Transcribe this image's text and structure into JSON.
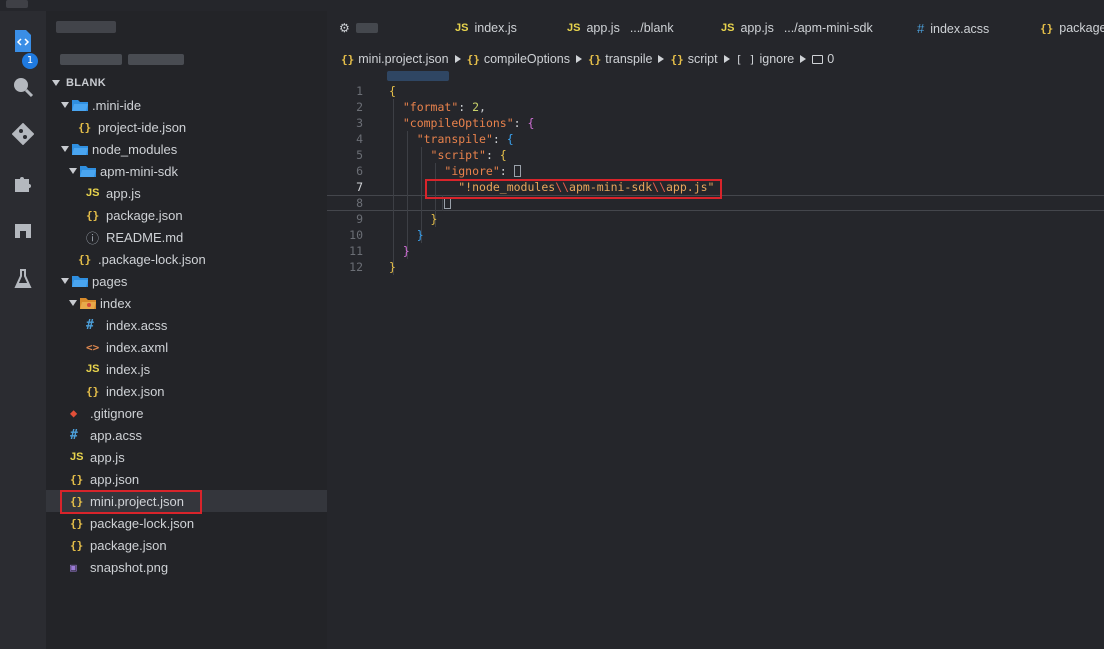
{
  "sidebar": {
    "section_title": "BLANK",
    "tree": [
      {
        "label": ".mini-ide",
        "icon": "folder-open-icon",
        "type": "folder",
        "indent": 1,
        "expanded": true
      },
      {
        "label": "project-ide.json",
        "icon": "json-icon",
        "type": "json",
        "indent": 2
      },
      {
        "label": "node_modules",
        "icon": "folder-open-icon",
        "type": "folder",
        "indent": 1,
        "expanded": true
      },
      {
        "label": "apm-mini-sdk",
        "icon": "folder-open-icon",
        "type": "folder",
        "indent": 2,
        "expanded": true
      },
      {
        "label": "app.js",
        "icon": "js-icon",
        "type": "js",
        "indent": 3
      },
      {
        "label": "package.json",
        "icon": "json-icon",
        "type": "json",
        "indent": 3
      },
      {
        "label": "README.md",
        "icon": "info-icon",
        "type": "info",
        "indent": 3
      },
      {
        "label": ".package-lock.json",
        "icon": "json-icon",
        "type": "json",
        "indent": 2
      },
      {
        "label": "pages",
        "icon": "folder-open-icon",
        "type": "folder",
        "indent": 1,
        "expanded": true
      },
      {
        "label": "index",
        "icon": "folder-special-icon",
        "type": "folder-special",
        "indent": 2,
        "expanded": true
      },
      {
        "label": "index.acss",
        "icon": "hash-icon",
        "type": "css",
        "indent": 3
      },
      {
        "label": "index.axml",
        "icon": "code-icon",
        "type": "xml",
        "indent": 3
      },
      {
        "label": "index.js",
        "icon": "js-icon",
        "type": "js",
        "indent": 3
      },
      {
        "label": "index.json",
        "icon": "json-icon",
        "type": "json",
        "indent": 3
      },
      {
        "label": ".gitignore",
        "icon": "git-icon",
        "type": "git",
        "indent": 1
      },
      {
        "label": "app.acss",
        "icon": "hash-icon",
        "type": "css",
        "indent": 1
      },
      {
        "label": "app.js",
        "icon": "js-icon",
        "type": "js",
        "indent": 1
      },
      {
        "label": "app.json",
        "icon": "json-icon",
        "type": "json",
        "indent": 1
      },
      {
        "label": "mini.project.json",
        "icon": "json-icon",
        "type": "json",
        "indent": 1,
        "selected": true
      },
      {
        "label": "package-lock.json",
        "icon": "json-icon",
        "type": "json",
        "indent": 1
      },
      {
        "label": "package.json",
        "icon": "json-icon",
        "type": "json",
        "indent": 1
      },
      {
        "label": "snapshot.png",
        "icon": "image-icon",
        "type": "img",
        "indent": 1
      }
    ]
  },
  "activity_bar": {
    "icons": [
      "explorer-icon",
      "search-icon",
      "git-branch-icon",
      "extensions-icon",
      "layout-icon",
      "flask-icon"
    ],
    "badge": "1"
  },
  "tabs": [
    {
      "label": "",
      "icon": "gear-icon",
      "sub": ""
    },
    {
      "label": "index.js",
      "icon": "JS",
      "sub": ""
    },
    {
      "label": "app.js",
      "icon": "JS",
      "sub": ".../blank"
    },
    {
      "label": "app.js",
      "icon": "JS",
      "sub": ".../apm-mini-sdk"
    },
    {
      "label": "index.acss",
      "icon": "#",
      "sub": ""
    },
    {
      "label": "package.",
      "icon": "{}",
      "sub": ""
    }
  ],
  "breadcrumbs": {
    "file": "mini.project.json",
    "parts": [
      "compileOptions",
      "transpile",
      "script",
      "ignore",
      "0"
    ],
    "brace_icon": "{}",
    "array_icon": "[ ]"
  },
  "code": {
    "lines": [
      {
        "n": "1"
      },
      {
        "n": "2"
      },
      {
        "n": "3"
      },
      {
        "n": "4"
      },
      {
        "n": "5"
      },
      {
        "n": "6"
      },
      {
        "n": "7"
      },
      {
        "n": "8"
      },
      {
        "n": "9"
      },
      {
        "n": "10"
      },
      {
        "n": "11"
      },
      {
        "n": "12"
      }
    ],
    "format_key": "\"format\"",
    "format_value": "2",
    "compileOptions_key": "\"compileOptions\"",
    "transpile_key": "\"transpile\"",
    "script_key": "\"script\"",
    "ignore_key": "\"ignore\"",
    "ignore_value_parts": [
      "\"!node_modules",
      "\\\\",
      "apm-mini-sdk",
      "\\\\",
      "app.js\""
    ],
    "active_line": "7"
  },
  "colors": {
    "accent": "#1f7ae0",
    "highlight_box": "#d8242b",
    "json_icon": "#e8c14a",
    "js_icon": "#e8d44d",
    "css_icon": "#4c9fd9"
  }
}
